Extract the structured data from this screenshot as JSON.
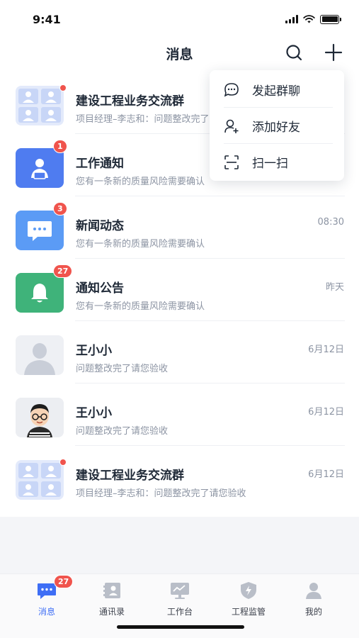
{
  "status_bar": {
    "time": "9:41"
  },
  "nav": {
    "title": "消息"
  },
  "colors": {
    "accent": "#3e6ef5",
    "badge": "#f0544d",
    "work_notice": "#4f7cf0",
    "news": "#5b9bf5",
    "announcement": "#3fb37a"
  },
  "messages": [
    {
      "title": "建设工程业务交流群",
      "subtitle": "项目经理–李志和：问题整改完了请您验收",
      "time": "",
      "avatar": "group-avatar",
      "badge": "",
      "dot": true
    },
    {
      "title": "工作通知",
      "subtitle": "您有一条新的质量风险需要确认",
      "time": "",
      "avatar": "work-notice-icon",
      "badge": "1",
      "dot": false
    },
    {
      "title": "新闻动态",
      "subtitle": "您有一条新的质量风险需要确认",
      "time": "08:30",
      "avatar": "news-chat-icon",
      "badge": "3",
      "dot": false
    },
    {
      "title": "通知公告",
      "subtitle": "您有一条新的质量风险需要确认",
      "time": "昨天",
      "avatar": "bell-icon",
      "badge": "27",
      "dot": false
    },
    {
      "title": "王小小",
      "subtitle": "问题整改完了请您验收",
      "time": "6月12日",
      "avatar": "default-user-avatar",
      "badge": "",
      "dot": false
    },
    {
      "title": "王小小",
      "subtitle": "问题整改完了请您验收",
      "time": "6月12日",
      "avatar": "cartoon-user-avatar",
      "badge": "",
      "dot": false
    },
    {
      "title": "建设工程业务交流群",
      "subtitle": "项目经理–李志和：问题整改完了请您验收",
      "time": "6月12日",
      "avatar": "group-avatar",
      "badge": "",
      "dot": true
    }
  ],
  "popup_menu": [
    {
      "label": "发起群聊",
      "icon": "chat-bubble-icon"
    },
    {
      "label": "添加好友",
      "icon": "add-friend-icon"
    },
    {
      "label": "扫一扫",
      "icon": "scan-icon"
    }
  ],
  "tabs": [
    {
      "label": "消息",
      "icon": "message-icon",
      "badge": "27",
      "active": true
    },
    {
      "label": "通讯录",
      "icon": "contacts-icon",
      "badge": "",
      "active": false
    },
    {
      "label": "工作台",
      "icon": "workbench-icon",
      "badge": "",
      "active": false
    },
    {
      "label": "工程监管",
      "icon": "shield-icon",
      "badge": "",
      "active": false
    },
    {
      "label": "我的",
      "icon": "profile-icon",
      "badge": "",
      "active": false
    }
  ]
}
